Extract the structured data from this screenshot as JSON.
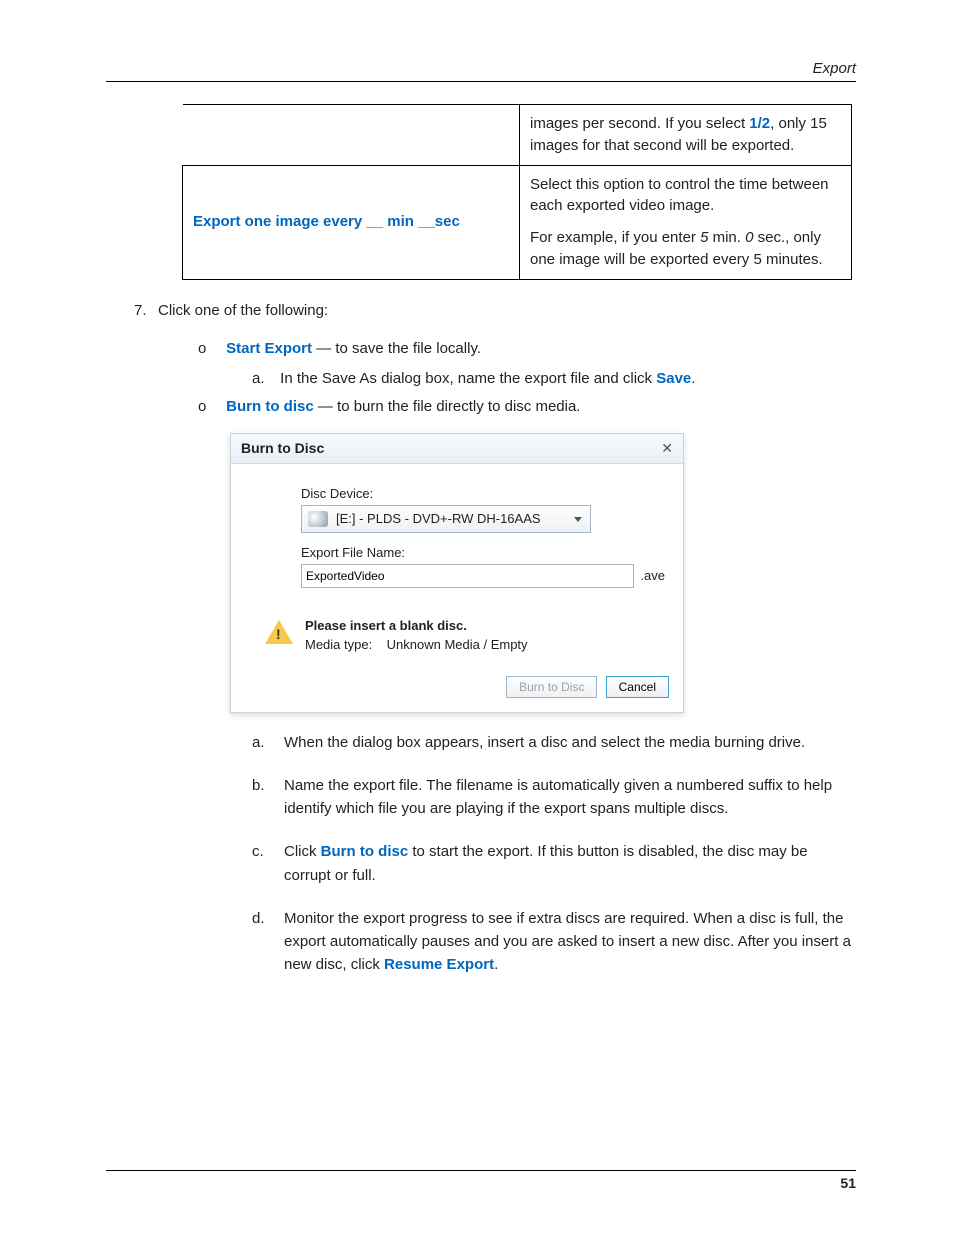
{
  "header": {
    "section": "Export"
  },
  "table": {
    "row0": {
      "right_a": "images per second. If you select ",
      "right_b": "1/2",
      "right_c": ", only 15 images for that second will be exported."
    },
    "row1": {
      "left": "Export one image every __ min __sec",
      "right_p1": "Select this option to control the time between each exported video image.",
      "right_p2a": "For example, if you enter ",
      "right_p2b": "5",
      "right_p2c": " min. ",
      "right_p2d": "0",
      "right_p2e": " sec., only one image will be exported every 5 minutes."
    }
  },
  "step7": {
    "num": "7.",
    "text": "Click one of the following:"
  },
  "options": {
    "a": {
      "mark": "o",
      "bold": "Start Export",
      "rest": " — to save the file locally."
    },
    "a_sub": {
      "mark": "a.",
      "text_a": "In the Save As dialog box, name the export file and click ",
      "text_b": "Save",
      "text_c": "."
    },
    "b": {
      "mark": "o",
      "bold": "Burn to disc",
      "rest": " — to burn the file directly to disc media."
    }
  },
  "dialog": {
    "title": "Burn to Disc",
    "close": "✕",
    "disc_label": "Disc Device:",
    "disc_value": "[E:] - PLDS - DVD+-RW DH-16AAS",
    "file_label": "Export File Name:",
    "file_value": "ExportedVideo",
    "file_ext": ".ave",
    "warn_bold": "Please insert a blank disc.",
    "warn_media_label": "Media type:",
    "warn_media_value": "Unknown Media / Empty",
    "btn_burn": "Burn to Disc",
    "btn_cancel": "Cancel"
  },
  "letters": {
    "a": {
      "lt": "a.",
      "text": "When the dialog box appears, insert a disc and select the media burning drive."
    },
    "b": {
      "lt": "b.",
      "text": "Name the export file. The filename is automatically given a numbered suffix to help identify which file you are playing if the export spans multiple discs."
    },
    "c": {
      "lt": "c.",
      "pre": "Click ",
      "bold": "Burn to disc",
      "post": " to start the export. If this button is disabled, the disc may be corrupt or full."
    },
    "d": {
      "lt": "d.",
      "pre": "Monitor the export progress to see if extra discs are required. When a disc is full, the export automatically pauses and you are asked to insert a new disc. After you insert a new disc, click ",
      "bold": "Resume Export",
      "post": "."
    }
  },
  "footer": {
    "page": "51"
  }
}
